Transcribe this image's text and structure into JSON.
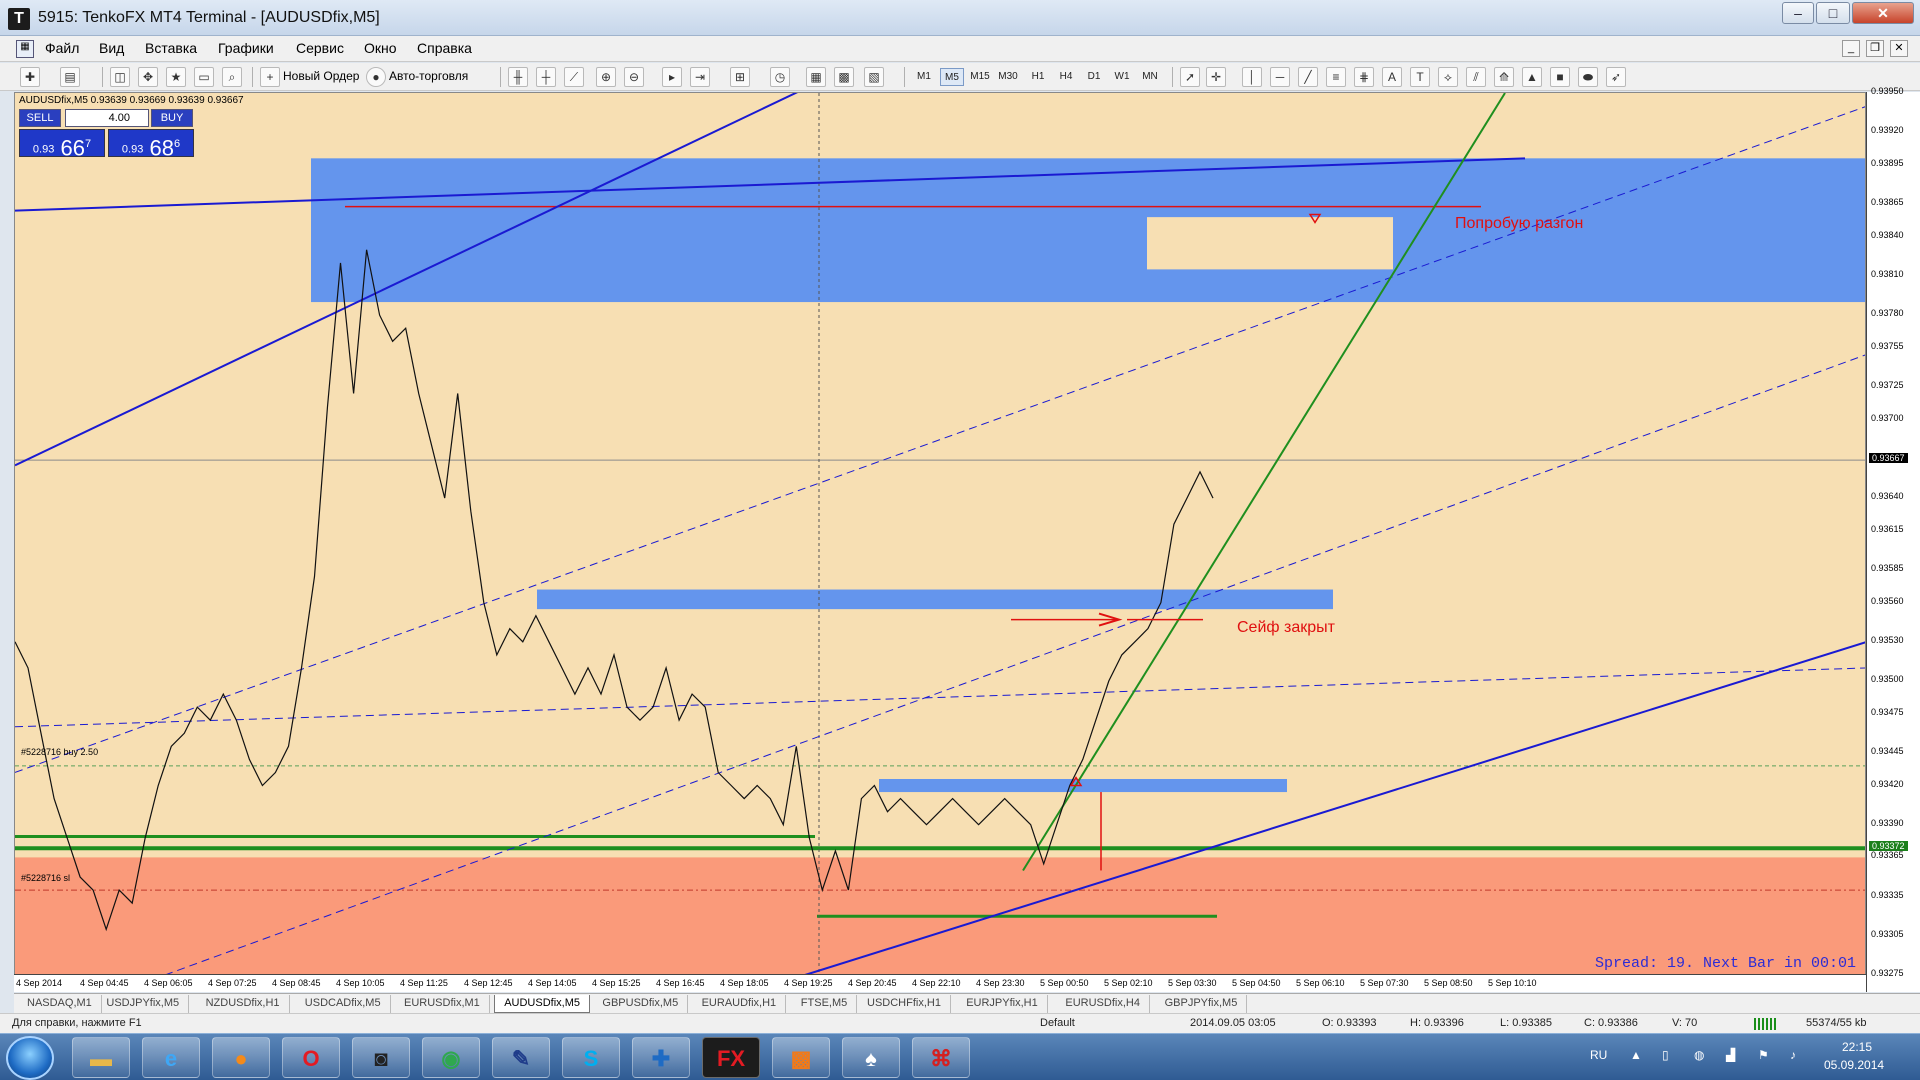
{
  "window": {
    "title": "5915: TenkoFX MT4 Terminal - [AUDUSDfix,M5]",
    "app_letter": "T",
    "min": "–",
    "max": "□",
    "close": "✕"
  },
  "menu": [
    "Файл",
    "Вид",
    "Вставка",
    "Графики",
    "Сервис",
    "Окно",
    "Справка"
  ],
  "toolbar": {
    "new_order": "Новый Ордер",
    "auto_trading": "Авто-торговля",
    "timeframes": [
      "M1",
      "M5",
      "M15",
      "M30",
      "H1",
      "H4",
      "D1",
      "W1",
      "MN"
    ],
    "active_timeframe": "M5"
  },
  "chart": {
    "symbol_line": "AUDUSDfix,M5  0.93639 0.93669 0.93639 0.93667",
    "sell_label": "SELL",
    "buy_label": "BUY",
    "lot": "4.00",
    "bid": {
      "prefix": "0.93",
      "big": "66",
      "sup": "7"
    },
    "ask": {
      "prefix": "0.93",
      "big": "68",
      "sup": "6"
    },
    "annotation_top": "Попробую разгон",
    "annotation_mid": "Сейф закрыт",
    "spread": "Spread: 19. Next Bar in 00:01",
    "order_buy": "#5228716 buy 2.50",
    "order_sl": "#5228716 sl",
    "colors": {
      "background": "#f7dfb3",
      "blue_zone": "#6495ed",
      "red_zone": "#fa9a7a",
      "trend_line": "#1a1ad2",
      "green_line": "#1f8f1f",
      "annotation": "#e01010"
    }
  },
  "chart_data": {
    "type": "line",
    "title": "",
    "xlabel": "",
    "ylabel": "",
    "ylim": [
      0.93275,
      0.9395
    ],
    "y_ticks": [
      "0.93950",
      "0.93920",
      "0.93895",
      "0.93865",
      "0.93840",
      "0.93810",
      "0.93780",
      "0.93755",
      "0.93725",
      "0.93700",
      "0.93670",
      "0.93640",
      "0.93615",
      "0.93585",
      "0.93560",
      "0.93530",
      "0.93500",
      "0.93475",
      "0.93445",
      "0.93420",
      "0.93390",
      "0.93365",
      "0.93335",
      "0.93305",
      "0.93275"
    ],
    "x_ticks": [
      "4 Sep 2014",
      "4 Sep 04:45",
      "4 Sep 06:05",
      "4 Sep 07:25",
      "4 Sep 08:45",
      "4 Sep 10:05",
      "4 Sep 11:25",
      "4 Sep 12:45",
      "4 Sep 14:05",
      "4 Sep 15:25",
      "4 Sep 16:45",
      "4 Sep 18:05",
      "4 Sep 19:25",
      "4 Sep 20:45",
      "4 Sep 22:10",
      "4 Sep 23:30",
      "5 Sep 00:50",
      "5 Sep 02:10",
      "5 Sep 03:30",
      "5 Sep 04:50",
      "5 Sep 06:10",
      "5 Sep 07:30",
      "5 Sep 08:50",
      "5 Sep 10:10"
    ],
    "current_price": "0.93667",
    "green_level": "0.93372",
    "series": [
      {
        "values": [
          0.9353,
          0.9351,
          0.9346,
          0.9341,
          0.9338,
          0.9335,
          0.9334,
          0.9331,
          0.9334,
          0.9333,
          0.9338,
          0.9342,
          0.9345,
          0.9346,
          0.9348,
          0.9347,
          0.9349,
          0.9347,
          0.9344,
          0.9342,
          0.9343,
          0.9345,
          0.9351,
          0.9358,
          0.9371,
          0.9382,
          0.9372,
          0.9383,
          0.9378,
          0.9376,
          0.9377,
          0.9372,
          0.9368,
          0.9364,
          0.9372,
          0.9363,
          0.9356,
          0.9352,
          0.9354,
          0.9353,
          0.9355,
          0.9353,
          0.9351,
          0.9349,
          0.9351,
          0.9349,
          0.9352,
          0.9348,
          0.9347,
          0.9348,
          0.9351,
          0.9347,
          0.9349,
          0.9348,
          0.9343,
          0.9342,
          0.9341,
          0.9342,
          0.9341,
          0.9339,
          0.9345,
          0.9338,
          0.9334,
          0.9337,
          0.9334,
          0.9341,
          0.9342,
          0.934,
          0.9341,
          0.934,
          0.9339,
          0.934,
          0.9341,
          0.934,
          0.9339,
          0.934,
          0.9341,
          0.934,
          0.9339,
          0.9336,
          0.9339,
          0.9342,
          0.9344,
          0.9347,
          0.935,
          0.9352,
          0.9353,
          0.9354,
          0.9356,
          0.9362,
          0.9364,
          0.9366,
          0.9364
        ]
      }
    ]
  },
  "tabs": [
    "NASDAQ,M1",
    "USDJPYfix,M5",
    "NZDUSDfix,H1",
    "USDCADfix,M5",
    "EURUSDfix,M1",
    "AUDUSDfix,M5",
    "GBPUSDfix,M5",
    "EURAUDfix,H1",
    "FTSE,M5",
    "USDCHFfix,H1",
    "EURJPYfix,H1",
    "EURUSDfix,H4",
    "GBPJPYfix,M5"
  ],
  "active_tab": "AUDUSDfix,M5",
  "status": {
    "help": "Для справки, нажмите F1",
    "profile": "Default",
    "datetime": "2014.09.05 03:05",
    "open": "O: 0.93393",
    "high": "H: 0.93396",
    "low": "L: 0.93385",
    "close": "C: 0.93386",
    "volume": "V: 70",
    "traffic": "55374/55 kb"
  },
  "taskbar": {
    "lang": "RU",
    "time": "22:15",
    "date": "05.09.2014",
    "apps": [
      "folder-icon",
      "ie-icon",
      "firefox-icon",
      "opera-icon",
      "camera-icon",
      "chrome-icon",
      "pen-icon",
      "skype-icon",
      "plus-icon",
      "tenko-icon",
      "paint-icon",
      "cards-icon",
      "pdf-icon"
    ]
  }
}
